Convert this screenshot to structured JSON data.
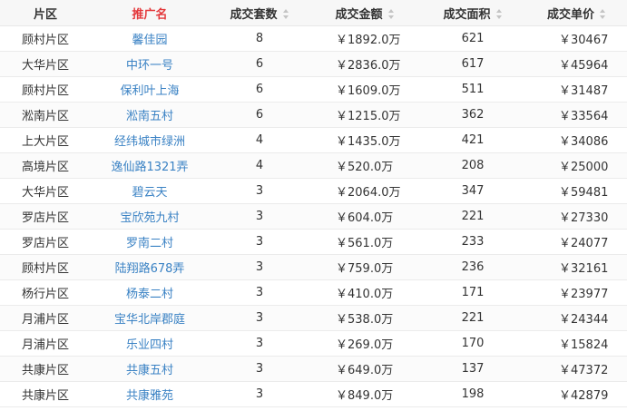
{
  "headers": {
    "area": "片区",
    "name": "推广名",
    "count": "成交套数",
    "amount": "成交金额",
    "size": "成交面积",
    "price": "成交单价"
  },
  "rows": [
    {
      "area": "顾村片区",
      "name": "馨佳园",
      "count": "8",
      "amount": "￥1892.0万",
      "size": "621",
      "price": "￥30467"
    },
    {
      "area": "大华片区",
      "name": "中环一号",
      "count": "6",
      "amount": "￥2836.0万",
      "size": "617",
      "price": "￥45964"
    },
    {
      "area": "顾村片区",
      "name": "保利叶上海",
      "count": "6",
      "amount": "￥1609.0万",
      "size": "511",
      "price": "￥31487"
    },
    {
      "area": "淞南片区",
      "name": "淞南五村",
      "count": "6",
      "amount": "￥1215.0万",
      "size": "362",
      "price": "￥33564"
    },
    {
      "area": "上大片区",
      "name": "经纬城市绿洲",
      "count": "4",
      "amount": "￥1435.0万",
      "size": "421",
      "price": "￥34086"
    },
    {
      "area": "高境片区",
      "name": "逸仙路1321弄",
      "count": "4",
      "amount": "￥520.0万",
      "size": "208",
      "price": "￥25000"
    },
    {
      "area": "大华片区",
      "name": "碧云天",
      "count": "3",
      "amount": "￥2064.0万",
      "size": "347",
      "price": "￥59481"
    },
    {
      "area": "罗店片区",
      "name": "宝欣苑九村",
      "count": "3",
      "amount": "￥604.0万",
      "size": "221",
      "price": "￥27330"
    },
    {
      "area": "罗店片区",
      "name": "罗南二村",
      "count": "3",
      "amount": "￥561.0万",
      "size": "233",
      "price": "￥24077"
    },
    {
      "area": "顾村片区",
      "name": "陆翔路678弄",
      "count": "3",
      "amount": "￥759.0万",
      "size": "236",
      "price": "￥32161"
    },
    {
      "area": "杨行片区",
      "name": "杨泰二村",
      "count": "3",
      "amount": "￥410.0万",
      "size": "171",
      "price": "￥23977"
    },
    {
      "area": "月浦片区",
      "name": "宝华北岸郡庭",
      "count": "3",
      "amount": "￥538.0万",
      "size": "221",
      "price": "￥24344"
    },
    {
      "area": "月浦片区",
      "name": "乐业四村",
      "count": "3",
      "amount": "￥269.0万",
      "size": "170",
      "price": "￥15824"
    },
    {
      "area": "共康片区",
      "name": "共康五村",
      "count": "3",
      "amount": "￥649.0万",
      "size": "137",
      "price": "￥47372"
    },
    {
      "area": "共康片区",
      "name": "共康雅苑",
      "count": "3",
      "amount": "￥849.0万",
      "size": "198",
      "price": "￥42879"
    }
  ],
  "colors": {
    "active_header": "#e4393c",
    "link": "#3a82c4",
    "header_bg": "#f7f7f7"
  }
}
